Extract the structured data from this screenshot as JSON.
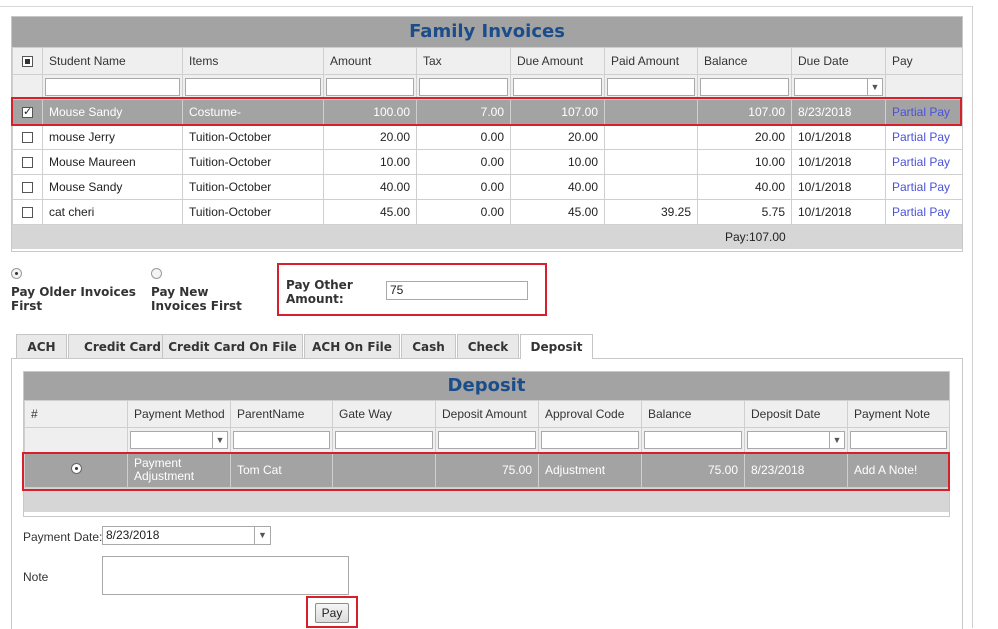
{
  "invoices": {
    "title": "Family Invoices",
    "columns": [
      "Student Name",
      "Items",
      "Amount",
      "Tax",
      "Due Amount",
      "Paid Amount",
      "Balance",
      "Due Date",
      "Pay"
    ],
    "rows": [
      {
        "student": "Mouse Sandy",
        "item": "Costume-",
        "amount": "100.00",
        "tax": "7.00",
        "due": "107.00",
        "paid": "",
        "balance": "107.00",
        "date": "8/23/2018",
        "pay": "Partial Pay",
        "checked": true
      },
      {
        "student": "mouse Jerry",
        "item": "Tuition-October",
        "amount": "20.00",
        "tax": "0.00",
        "due": "20.00",
        "paid": "",
        "balance": "20.00",
        "date": "10/1/2018",
        "pay": "Partial Pay",
        "checked": false
      },
      {
        "student": "Mouse Maureen",
        "item": "Tuition-October",
        "amount": "10.00",
        "tax": "0.00",
        "due": "10.00",
        "paid": "",
        "balance": "10.00",
        "date": "10/1/2018",
        "pay": "Partial Pay",
        "checked": false
      },
      {
        "student": "Mouse Sandy",
        "item": "Tuition-October",
        "amount": "40.00",
        "tax": "0.00",
        "due": "40.00",
        "paid": "",
        "balance": "40.00",
        "date": "10/1/2018",
        "pay": "Partial Pay",
        "checked": false
      },
      {
        "student": "cat cheri",
        "item": "Tuition-October",
        "amount": "45.00",
        "tax": "0.00",
        "due": "45.00",
        "paid": "39.25",
        "balance": "5.75",
        "date": "10/1/2018",
        "pay": "Partial Pay",
        "checked": false
      }
    ],
    "footer_total": "Pay:107.00"
  },
  "options": {
    "older_label": "Pay Older Invoices First",
    "new_label": "Pay New Invoices First",
    "other_label": "Pay Other Amount:",
    "other_value": "75"
  },
  "tabs": [
    "ACH",
    "Credit Card",
    "Credit Card On File",
    "ACH On File",
    "Cash",
    "Check",
    "Deposit"
  ],
  "active_tab": "Deposit",
  "deposit": {
    "title": "Deposit",
    "columns": [
      "#",
      "Payment Method",
      "ParentName",
      "Gate Way",
      "Deposit Amount",
      "Approval Code",
      "Balance",
      "Deposit Date",
      "Payment Note"
    ],
    "row": {
      "method": "Payment Adjustment",
      "parent": "Tom Cat",
      "gateway": "",
      "amount": "75.00",
      "approval": "Adjustment",
      "balance": "75.00",
      "date": "8/23/2018",
      "note": "Add A Note!"
    }
  },
  "form": {
    "payment_date_label": "Payment Date:",
    "payment_date_value": "8/23/2018",
    "note_label": "Note",
    "pay_button": "Pay"
  },
  "colors": {
    "highlight": "#d8202c",
    "title_text": "#1b4d8a",
    "header_bg": "#a3a3a3",
    "link": "#4a52d8"
  }
}
